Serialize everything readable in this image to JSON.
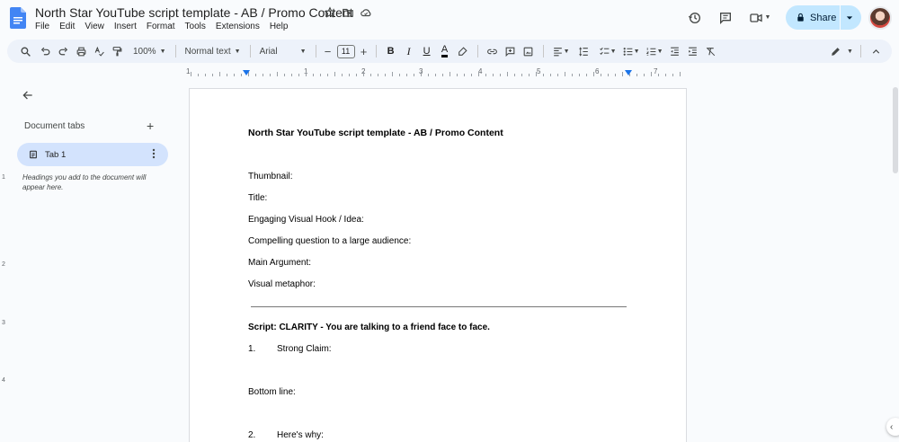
{
  "app": {
    "doc_title": "North Star YouTube script template - AB / Promo Content",
    "menu": [
      "File",
      "Edit",
      "View",
      "Insert",
      "Format",
      "Tools",
      "Extensions",
      "Help"
    ],
    "share_label": "Share"
  },
  "toolbar": {
    "zoom": "100%",
    "style": "Normal text",
    "font": "Arial",
    "font_size": "11",
    "bold": "B",
    "italic": "I",
    "underline": "U",
    "text_color": "A"
  },
  "ruler": {
    "numbers": [
      "1",
      "1",
      "2",
      "3",
      "4",
      "5",
      "6",
      "7"
    ],
    "vertical_numbers": [
      "1",
      "2",
      "3",
      "4"
    ]
  },
  "sidebar": {
    "tabs_header": "Document tabs",
    "add_symbol": "+",
    "tab_label": "Tab 1",
    "help_text": "Headings you add to the document will appear here."
  },
  "document": {
    "heading": "North Star YouTube script template - AB / Promo Content",
    "fields": [
      "Thumbnail:",
      "Title:",
      "Engaging Visual Hook / Idea:",
      "Compelling question to a large audience:",
      "Main Argument:",
      "Visual metaphor:"
    ],
    "script_heading": "Script: CLARITY - You are talking to a friend face to face.",
    "item1_num": "1.",
    "item1_text": "Strong Claim:",
    "bottom_line": "Bottom line:",
    "item2_num": "2.",
    "item2_text": "Here's why:"
  },
  "colors": {
    "accent": "#1a73e8",
    "share_bg": "#c2e7ff",
    "tab_active_bg": "#d3e3fd",
    "toolbar_bg": "#edf2fa"
  }
}
